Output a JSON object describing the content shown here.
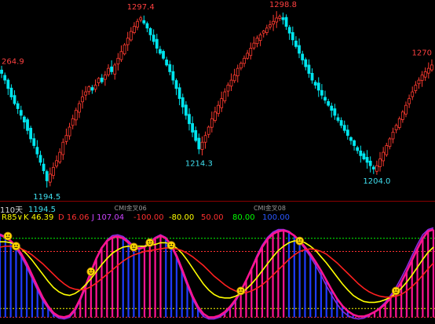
{
  "chart_data": [
    {
      "type": "candlestick",
      "ylim": [
        1188,
        1303
      ],
      "price_labels": [
        {
          "text": "1297.4",
          "value": 1297.4,
          "kind": "high",
          "idx": 43
        },
        {
          "text": "1298.8",
          "value": 1298.8,
          "kind": "high",
          "idx": 87
        },
        {
          "text": "264.9",
          "value": 1264.9,
          "kind": "high",
          "idx": 0
        },
        {
          "text": "1270",
          "value": 1270.0,
          "kind": "high",
          "idx": 133
        },
        {
          "text": "1214.3",
          "value": 1214.3,
          "kind": "low",
          "idx": 61
        },
        {
          "text": "1194.5",
          "value": 1194.5,
          "kind": "low",
          "idx": 14
        },
        {
          "text": "1204.0",
          "value": 1204.0,
          "kind": "low",
          "idx": 116
        }
      ],
      "markers": [
        "CMI金叉06",
        "CMI金叉08"
      ],
      "closes": [
        1263.0,
        1259.0,
        1254.0,
        1249.0,
        1245.0,
        1242.0,
        1238.0,
        1234.0,
        1229.0,
        1224.0,
        1220.0,
        1215.0,
        1210.0,
        1205.0,
        1199.0,
        1203.0,
        1207.0,
        1211.0,
        1216.0,
        1222.0,
        1226.0,
        1231.0,
        1236.0,
        1241.0,
        1245.0,
        1249.0,
        1252.0,
        1255.0,
        1253.0,
        1256.0,
        1260.0,
        1258.0,
        1262.0,
        1266.0,
        1264.0,
        1268.0,
        1272.0,
        1276.0,
        1280.0,
        1284.0,
        1288.0,
        1291.0,
        1294.0,
        1296.0,
        1293.0,
        1290.0,
        1286.0,
        1282.0,
        1278.0,
        1275.0,
        1272.0,
        1268.0,
        1264.0,
        1259.0,
        1254.0,
        1248.0,
        1243.0,
        1238.0,
        1233.0,
        1228.0,
        1223.0,
        1218.0,
        1222.0,
        1226.0,
        1231.0,
        1236.0,
        1240.0,
        1244.0,
        1248.0,
        1252.0,
        1256.0,
        1259.0,
        1262.0,
        1266.0,
        1269.0,
        1272.0,
        1275.0,
        1278.0,
        1281.0,
        1284.0,
        1286.0,
        1288.0,
        1290.0,
        1292.0,
        1294.0,
        1296.0,
        1297.0,
        1295.0,
        1291.0,
        1287.0,
        1283.0,
        1279.0,
        1275.0,
        1271.0,
        1267.0,
        1263.0,
        1259.0,
        1256.0,
        1253.0,
        1250.0,
        1247.0,
        1244.0,
        1241.0,
        1238.0,
        1235.0,
        1232.0,
        1229.0,
        1226.0,
        1223.0,
        1220.0,
        1217.0,
        1214.0,
        1212.0,
        1210.0,
        1208.0,
        1206.0,
        1208.0,
        1212.0,
        1216.0,
        1220.0,
        1224.0,
        1228.0,
        1232.0,
        1236.0,
        1240.0,
        1244.0,
        1248.0,
        1252.0,
        1256.0,
        1259.0,
        1262.0,
        1264.0,
        1266.0,
        1268.0
      ]
    },
    {
      "type": "line",
      "indicator_name": "KDJ",
      "timeframe_label": "110天",
      "price_note": "1194.5",
      "params": [
        {
          "text": "R85∨",
          "color": "#ffff00"
        },
        {
          "text": "K 46.39",
          "color": "#ffff00"
        },
        {
          "text": "D 16.06",
          "color": "#ff3030"
        },
        {
          "text": "J 107.04",
          "color": "#cc44ff"
        },
        {
          "text": "-100.00",
          "color": "#ff3030"
        },
        {
          "text": "-80.00",
          "color": "#ffff00"
        },
        {
          "text": "50.00",
          "color": "#ff3030"
        },
        {
          "text": "80.00",
          "color": "#00ff00"
        },
        {
          "text": "100.00",
          "color": "#2a57ff"
        }
      ],
      "ylim": [
        -110,
        110
      ],
      "reference_lines": [
        {
          "value": 80,
          "color": "#00ff00"
        },
        {
          "value": 50,
          "color": "#ff3030"
        },
        {
          "value": -80,
          "color": "#ffff00"
        },
        {
          "value": -100,
          "color": "#ff3030"
        }
      ],
      "series": [
        {
          "color": "#ff1493",
          "values": [
            88.0,
            82.0,
            74.0,
            62.0,
            44.0,
            22.0,
            -4.0,
            -30.0,
            -55.0,
            -75.0,
            -90.0,
            -98.0,
            -100.0,
            -96.0,
            -82.0,
            -58.0,
            -28.0,
            4.0,
            34.0,
            58.0,
            74.0,
            82.0,
            84.0,
            80.0,
            70.0,
            60.0,
            56.0,
            60.0,
            70.0,
            80.0,
            86.0,
            80.0,
            64.0,
            40.0,
            10.0,
            -22.0,
            -52.0,
            -76.0,
            -92.0,
            -100.0,
            -100.0,
            -96.0,
            -88.0,
            -76.0,
            -60.0,
            -40.0,
            -16.0,
            10.0,
            36.0,
            60.0,
            78.0,
            90.0,
            96.0,
            98.0,
            94.0,
            86.0,
            74.0,
            60.0,
            44.0,
            26.0,
            6.0,
            -16.0,
            -38.0,
            -58.0,
            -74.0,
            -86.0,
            -94.0,
            -98.0,
            -98.0,
            -94.0,
            -88.0,
            -80.0,
            -70.0,
            -56.0,
            -40.0,
            -20.0,
            4.0,
            30.0,
            56.0,
            80.0,
            96.0,
            100.0
          ]
        },
        {
          "color": "#ffff00",
          "values": [
            72.0,
            72.0,
            70.0,
            64.0,
            56.0,
            44.0,
            30.0,
            14.0,
            -2.0,
            -18.0,
            -32.0,
            -42.0,
            -48.0,
            -50.0,
            -46.0,
            -38.0,
            -26.0,
            -12.0,
            4.0,
            20.0,
            34.0,
            46.0,
            54.0,
            60.0,
            62.0,
            62.0,
            62.0,
            62.0,
            64.0,
            66.0,
            70.0,
            70.0,
            66.0,
            58.0,
            46.0,
            30.0,
            12.0,
            -6.0,
            -24.0,
            -38.0,
            -48.0,
            -54.0,
            -56.0,
            -56.0,
            -52.0,
            -46.0,
            -36.0,
            -24.0,
            -10.0,
            6.0,
            22.0,
            38.0,
            52.0,
            62.0,
            70.0,
            74.0,
            74.0,
            70.0,
            62.0,
            52.0,
            38.0,
            24.0,
            8.0,
            -8.0,
            -24.0,
            -38.0,
            -50.0,
            -58.0,
            -64.0,
            -66.0,
            -66.0,
            -64.0,
            -60.0,
            -54.0,
            -46.0,
            -34.0,
            -20.0,
            -4.0,
            14.0,
            32.0,
            48.0,
            60.0
          ]
        },
        {
          "color": "#ff2020",
          "values": [
            60.0,
            62.0,
            62.0,
            60.0,
            56.0,
            50.0,
            42.0,
            32.0,
            22.0,
            10.0,
            -2.0,
            -14.0,
            -24.0,
            -32.0,
            -36.0,
            -38.0,
            -36.0,
            -30.0,
            -22.0,
            -12.0,
            -2.0,
            8.0,
            18.0,
            28.0,
            36.0,
            42.0,
            46.0,
            50.0,
            52.0,
            54.0,
            56.0,
            58.0,
            58.0,
            56.0,
            52.0,
            46.0,
            38.0,
            28.0,
            18.0,
            6.0,
            -6.0,
            -16.0,
            -26.0,
            -34.0,
            -40.0,
            -44.0,
            -44.0,
            -40.0,
            -34.0,
            -26.0,
            -16.0,
            -4.0,
            8.0,
            20.0,
            32.0,
            42.0,
            50.0,
            54.0,
            56.0,
            54.0,
            50.0,
            44.0,
            34.0,
            24.0,
            12.0,
            0.0,
            -12.0,
            -24.0,
            -34.0,
            -42.0,
            -48.0,
            -52.0,
            -54.0,
            -54.0,
            -52.0,
            -48.0,
            -40.0,
            -30.0,
            -18.0,
            -4.0,
            10.0,
            24.0
          ]
        },
        {
          "color": "#8a2be2",
          "values": [
            90.0,
            84.0,
            74.0,
            58.0,
            38.0,
            14.0,
            -12.0,
            -38.0,
            -62.0,
            -80.0,
            -94.0,
            -102.0,
            -104.0,
            -100.0,
            -86.0,
            -62.0,
            -32.0,
            0.0,
            32.0,
            58.0,
            76.0,
            86.0,
            88.0,
            84.0,
            74.0,
            62.0,
            58.0,
            62.0,
            72.0,
            82.0,
            88.0,
            82.0,
            62.0,
            36.0,
            4.0,
            -28.0,
            -58.0,
            -82.0,
            -98.0,
            -104.0,
            -104.0,
            -100.0,
            -92.0,
            -80.0,
            -64.0,
            -42.0,
            -16.0,
            12.0,
            40.0,
            64.0,
            82.0,
            94.0,
            100.0,
            100.0,
            96.0,
            86.0,
            72.0,
            56.0,
            38.0,
            18.0,
            -4.0,
            -28.0,
            -50.0,
            -70.0,
            -86.0,
            -96.0,
            -102.0,
            -104.0,
            -102.0,
            -96.0,
            -88.0,
            -78.0,
            -66.0,
            -50.0,
            -32.0,
            -10.0,
            14.0,
            40.0,
            66.0,
            88.0,
            100.0,
            104.0
          ]
        }
      ]
    }
  ]
}
